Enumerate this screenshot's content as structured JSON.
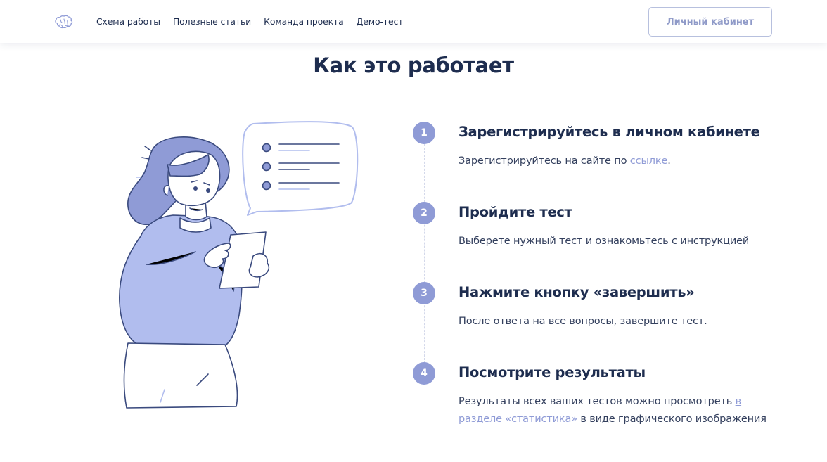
{
  "header": {
    "logo_icon": "brain-icon",
    "nav": [
      "Схема работы",
      "Полезные статьи",
      "Команда проекта",
      "Демо-тест"
    ],
    "cabinet_label": "Личный кабинет"
  },
  "main": {
    "title": "Как это работает",
    "steps": [
      {
        "number": "1",
        "title": "Зарегистрируйтесь в личном кабинете",
        "text": "Зарегистрируйтесь на сайте по ",
        "link": "ссылке",
        "text_after": "."
      },
      {
        "number": "2",
        "title": "Пройдите тест",
        "text": "Выберете нужный тест и ознакомьтесь с инструкцией"
      },
      {
        "number": "3",
        "title": "Нажмите кнопку «завершить»",
        "text": "После ответа на все вопросы, завершите тест."
      },
      {
        "number": "4",
        "title": "Посмотрите результаты",
        "text": "Результаты всех ваших тестов можно просмотреть ",
        "link": "в разделе «статистика»",
        "text_after": " в виде графического изображения"
      }
    ]
  },
  "colors": {
    "accent": "#8f9bd6",
    "text_dark": "#1e2d4f",
    "illustration_fill": "#b1bdee",
    "illustration_stroke": "#3a4a7e"
  }
}
